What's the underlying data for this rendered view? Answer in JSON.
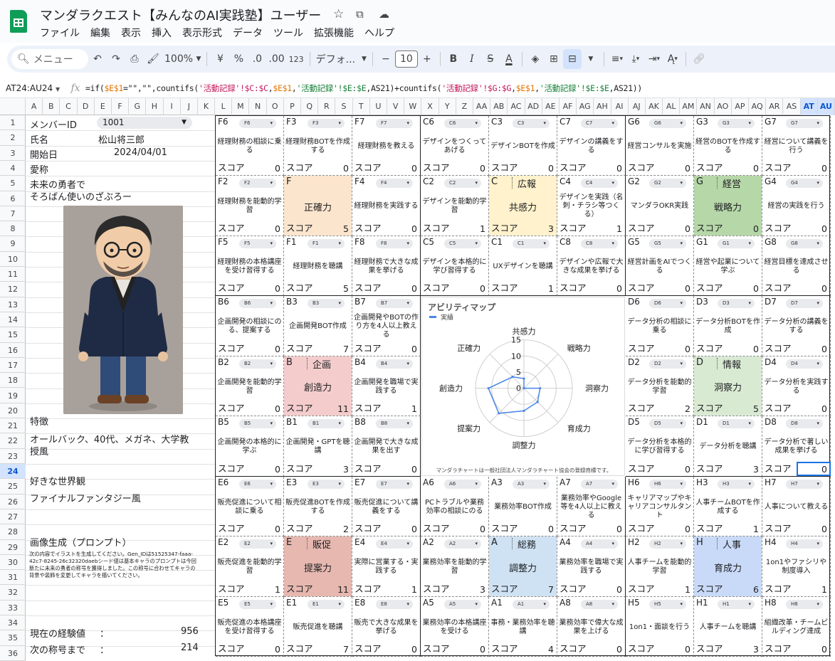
{
  "window": {
    "doc_title": "マンダラクエスト【みんなのAI実践塾】ユーザー"
  },
  "icons": {
    "star": "star-icon",
    "move": "move-to-folder-icon",
    "cloud": "cloud-status-icon"
  },
  "menu": [
    "ファイル",
    "編集",
    "表示",
    "挿入",
    "表示形式",
    "データ",
    "ツール",
    "拡張機能",
    "ヘルプ"
  ],
  "toolbar": {
    "search_placeholder": "メニュー",
    "zoom": "100%",
    "currency": "¥",
    "percent": "%",
    "decimal_less": ".0",
    "decimal_more": ".00",
    "number_format": "123",
    "font": "デフォ...",
    "font_size": "10",
    "minus": "−",
    "plus": "+",
    "bold": "B",
    "italic": "I",
    "strike": "S",
    "text_color": "A"
  },
  "formula_bar": {
    "namebox": "AT24:AU24",
    "fx": "fx"
  },
  "columns": [
    "A",
    "B",
    "C",
    "D",
    "E",
    "F",
    "G",
    "H",
    "I",
    "J",
    "K",
    "L",
    "M",
    "N",
    "O",
    "P",
    "Q",
    "R",
    "S",
    "T",
    "U",
    "V",
    "W",
    "X",
    "Y",
    "Z",
    "AA",
    "AB",
    "AC",
    "AD",
    "AE",
    "AF",
    "AG",
    "AH",
    "AI",
    "AJ",
    "AK",
    "AL",
    "AM",
    "AN",
    "AO",
    "AP",
    "AQ",
    "AR",
    "AS",
    "AT",
    "AU"
  ],
  "rows": [
    "1",
    "2",
    "3",
    "4",
    "5",
    "6",
    "7",
    "8",
    "9",
    "10",
    "11",
    "12",
    "13",
    "14",
    "15",
    "16",
    "17",
    "18",
    "19",
    "20",
    "21",
    "22",
    "23",
    "24",
    "25",
    "26",
    "27",
    "28",
    "29",
    "30",
    "31",
    "32",
    "33",
    "34",
    "35",
    "36"
  ],
  "profile": {
    "member_id_label": "メンバーID",
    "member_id": "1001",
    "name_label": "氏名",
    "name": "松山将三郎",
    "start_label": "開始日",
    "start": "2024/04/01",
    "alias_label": "愛称",
    "alias_line1": "未来の勇者で",
    "alias_line2": "そろばん使いのざぶろー",
    "feature_label": "特徴",
    "feature_line1": "オールバック、40代、メガネ、大学教",
    "feature_line2": "授風",
    "world_label": "好きな世界観",
    "world": "ファイナルファンタジー風",
    "prompt_label": "画像生成（プロンプト）",
    "prompt_text": "次の内容でイラストを生成してください。Gen_IDは51525347-faaa-42c7-8245-26c32320daebシード値は基本キャラのプロンプトは今回新たに未来の勇者の称号を獲得しました。この称号に合わせてキャラの背景や装飾を変更してキャラを描いてください。",
    "exp_label": "現在の経験値",
    "exp_sep": "：",
    "exp": "956",
    "next_label": "次の称号まで",
    "next_sep": "：",
    "next": "214"
  },
  "score_label": "スコア",
  "mandala": [
    {
      "code": "F6",
      "chip": "F6",
      "desc": "経理財務の相談に乗る",
      "score": "0"
    },
    {
      "code": "F3",
      "chip": "F3",
      "desc": "経理財務BOTを作成する",
      "score": "0"
    },
    {
      "code": "F7",
      "chip": "F7",
      "desc": "経理財務を教える",
      "score": "0"
    },
    {
      "code": "C6",
      "chip": "C6",
      "desc": "デザインをつくってあげる",
      "score": "0"
    },
    {
      "code": "C3",
      "chip": "C3",
      "desc": "デザインBOTを作成",
      "score": "0"
    },
    {
      "code": "C7",
      "chip": "C7",
      "desc": "デザインの講義をする",
      "score": "0"
    },
    {
      "code": "G6",
      "chip": "G6",
      "desc": "経営コンサルを実施",
      "score": "0"
    },
    {
      "code": "G3",
      "chip": "G3",
      "desc": "経営のBOTを作成する",
      "score": "0"
    },
    {
      "code": "G7",
      "chip": "G7",
      "desc": "経営について講義を行う",
      "score": "0"
    },
    {
      "code": "F2",
      "chip": "F2",
      "desc": "経理財務を能動的学習",
      "score": "0"
    },
    {
      "center": true,
      "title": "F",
      "label": "",
      "name": "正確力",
      "score": "5",
      "color": "#fce5cd"
    },
    {
      "code": "F4",
      "chip": "F4",
      "desc": "経理財務を実践する",
      "score": "0"
    },
    {
      "code": "C2",
      "chip": "C2",
      "desc": "デザインを能動的学習",
      "score": "1"
    },
    {
      "center": true,
      "title": "C",
      "label": "広報",
      "name": "共感力",
      "score": "3",
      "color": "#fff2cc"
    },
    {
      "code": "C4",
      "chip": "C4",
      "desc": "デザインを実践（名刺・チラシ等つくる）",
      "score": "1"
    },
    {
      "code": "G2",
      "chip": "G2",
      "desc": "マンダラOKR実践",
      "score": "0"
    },
    {
      "center": true,
      "title": "G",
      "label": "経営",
      "name": "戦略力",
      "score": "0",
      "color": "#b6d7a8"
    },
    {
      "code": "G4",
      "chip": "G4",
      "desc": "経営の実践を行う",
      "score": "0"
    },
    {
      "code": "F5",
      "chip": "F5",
      "desc": "経理財務の本格講座を受け習得する",
      "score": "0"
    },
    {
      "code": "F1",
      "chip": "F1",
      "desc": "経理財務を聴講",
      "score": "5"
    },
    {
      "code": "F8",
      "chip": "F8",
      "desc": "経理財務で大きな成果を挙げる",
      "score": "0"
    },
    {
      "code": "C5",
      "chip": "C5",
      "desc": "デザインを本格的に学び習得する",
      "score": "0"
    },
    {
      "code": "C1",
      "chip": "C1",
      "desc": "UXデザインを聴講",
      "score": "1"
    },
    {
      "code": "C8",
      "chip": "C8",
      "desc": "デザインや広報で大きな成果を挙げる",
      "score": "0"
    },
    {
      "code": "G5",
      "chip": "G5",
      "desc": "経営計画をAIでつくる",
      "score": "0"
    },
    {
      "code": "G1",
      "chip": "G1",
      "desc": "経営や起業について学ぶ",
      "score": "0"
    },
    {
      "code": "G8",
      "chip": "G8",
      "desc": "経営目標を達成させる",
      "score": "0"
    },
    {
      "code": "B6",
      "chip": "B6",
      "desc": "企画開発の相談にのる、提案する",
      "score": "0"
    },
    {
      "code": "B3",
      "chip": "B3",
      "desc": "企画開発BOT作成",
      "score": "7"
    },
    {
      "code": "B7",
      "chip": "B7",
      "desc": "企画開発やBOTの作り方を4人以上教える",
      "score": "0"
    },
    {
      "chart": true
    },
    {
      "chart": true
    },
    {
      "chart": true
    },
    {
      "code": "D6",
      "chip": "D6",
      "desc": "データ分析の相談に乗る",
      "score": "0"
    },
    {
      "code": "D3",
      "chip": "D3",
      "desc": "データ分析BOTを作成",
      "score": "0"
    },
    {
      "code": "D7",
      "chip": "D7",
      "desc": "データ分析の講義をする",
      "score": "0"
    },
    {
      "code": "B2",
      "chip": "B2",
      "desc": "企画開発を能動的学習",
      "score": "0"
    },
    {
      "center": true,
      "title": "B",
      "label": "企画",
      "name": "創造力",
      "score": "11",
      "color": "#f4cccc"
    },
    {
      "code": "B4",
      "chip": "B4",
      "desc": "企画開発を職場で実践する",
      "score": "1"
    },
    {
      "chart": true
    },
    {
      "chart": true
    },
    {
      "chart": true
    },
    {
      "code": "D2",
      "chip": "D2",
      "desc": "データ分析を能動的学習",
      "score": "2"
    },
    {
      "center": true,
      "title": "D",
      "label": "情報",
      "name": "洞察力",
      "score": "5",
      "color": "#d9ead3"
    },
    {
      "code": "D4",
      "chip": "D4",
      "desc": "データ分析を実践する",
      "score": "0"
    },
    {
      "code": "B5",
      "chip": "B5",
      "desc": "企画開発の本格的に学ぶ",
      "score": "0"
    },
    {
      "code": "B1",
      "chip": "B1",
      "desc": "企画開発・GPTを聴講",
      "score": "3"
    },
    {
      "code": "B8",
      "chip": "B8",
      "desc": "企画開発で大きな成果を出す",
      "score": "0"
    },
    {
      "chart": true
    },
    {
      "chart": true
    },
    {
      "chart": true
    },
    {
      "code": "D5",
      "chip": "D5",
      "desc": "データ分析を本格的に学び習得する",
      "score": "0"
    },
    {
      "code": "D1",
      "chip": "D1",
      "desc": "データ分析を聴講",
      "score": "3"
    },
    {
      "code": "D8",
      "chip": "D8",
      "desc": "データ分析で著しい成果を挙げる",
      "score": "0"
    },
    {
      "code": "E6",
      "chip": "E6",
      "desc": "販売促進について相談に乗る",
      "score": "0"
    },
    {
      "code": "E3",
      "chip": "E3",
      "desc": "販売促進BOTを作成する",
      "score": "2"
    },
    {
      "code": "E7",
      "chip": "E7",
      "desc": "販売促進について講義をする",
      "score": "0"
    },
    {
      "code": "A6",
      "chip": "A6",
      "desc": "PCトラブルや業務効率の相談にのる",
      "score": "0"
    },
    {
      "code": "A3",
      "chip": "A3",
      "desc": "業務効率BOT作成",
      "score": "0"
    },
    {
      "code": "A7",
      "chip": "A7",
      "desc": "業務効率やGoogle等を4人以上に教える",
      "score": "0"
    },
    {
      "code": "H6",
      "chip": "H6",
      "desc": "キャリアマップやキャリアコンサルタント",
      "score": "0"
    },
    {
      "code": "H3",
      "chip": "H3",
      "desc": "人事チームBOTを作成する",
      "score": "1"
    },
    {
      "code": "H7",
      "chip": "H7",
      "desc": "人事について教える",
      "score": "0"
    },
    {
      "code": "E2",
      "chip": "E2",
      "desc": "販売促進を能動的学習",
      "score": "1"
    },
    {
      "center": true,
      "title": "E",
      "label": "販促",
      "name": "提案力",
      "score": "11",
      "color": "#e6b8af"
    },
    {
      "code": "E4",
      "chip": "E4",
      "desc": "実際に営業する・実践する",
      "score": "1"
    },
    {
      "code": "A2",
      "chip": "A2",
      "desc": "業務効率を能動的学習",
      "score": "3"
    },
    {
      "center": true,
      "title": "A",
      "label": "総務",
      "name": "調整力",
      "score": "7",
      "color": "#cfe2f3"
    },
    {
      "code": "A4",
      "chip": "A4",
      "desc": "業務効率を職場で実践する",
      "score": "0"
    },
    {
      "code": "H2",
      "chip": "H2",
      "desc": "人事チームを能動的学習",
      "score": "1"
    },
    {
      "center": true,
      "title": "H",
      "label": "人事",
      "name": "育成力",
      "score": "6",
      "color": "#c9daf8"
    },
    {
      "code": "H4",
      "chip": "H4",
      "desc": "1on1やファシリや制度導入",
      "score": "1"
    },
    {
      "code": "E5",
      "chip": "E5",
      "desc": "販売促進の本格講座を受け習得する",
      "score": "0"
    },
    {
      "code": "E1",
      "chip": "E1",
      "desc": "販売促進を聴講",
      "score": "7"
    },
    {
      "code": "E8",
      "chip": "E8",
      "desc": "販売で大きな成果を挙げる",
      "score": "0"
    },
    {
      "code": "A5",
      "chip": "A5",
      "desc": "業務効率の本格講座を受ける",
      "score": "0"
    },
    {
      "code": "A1",
      "chip": "A1",
      "desc": "事務・業務効率を聴講",
      "score": "4"
    },
    {
      "code": "A8",
      "chip": "A8",
      "desc": "業務効率で偉大な成果を上げる",
      "score": "0"
    },
    {
      "code": "H5",
      "chip": "H5",
      "desc": "1on1・面談を行う",
      "score": "0"
    },
    {
      "code": "H1",
      "chip": "H1",
      "desc": "人事チームを聴講",
      "score": "3"
    },
    {
      "code": "H8",
      "chip": "H8",
      "desc": "組織改革・チームビルディング達成",
      "score": "0"
    }
  ],
  "chart_data": {
    "type": "radar",
    "title": "アビリティマップ",
    "legend": [
      "実績"
    ],
    "legend_position": "top-left",
    "categories": [
      "共感力",
      "戦略力",
      "洞察力",
      "育成力",
      "調整力",
      "提案力",
      "創造力",
      "正確力"
    ],
    "series": [
      {
        "name": "実績",
        "values": [
          3,
          0,
          5,
          6,
          7,
          11,
          11,
          5
        ],
        "color": "#4a86e8"
      }
    ],
    "ticks": [
      "0",
      "5",
      "10",
      "15"
    ],
    "rlim": [
      0,
      15
    ],
    "footnote": "マンダラチャートは一般社団法人マンダラチャート協会の登録商標です。"
  }
}
